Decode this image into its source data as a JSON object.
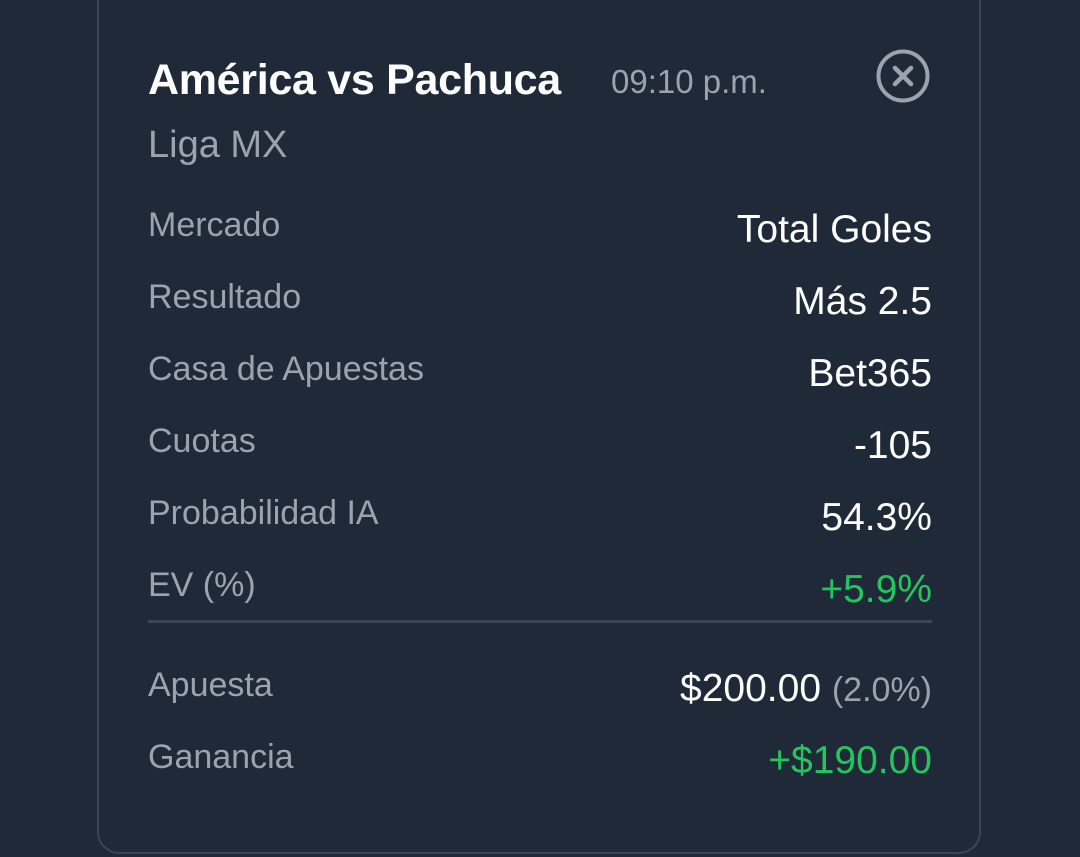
{
  "header": {
    "match": "América vs Pachuca",
    "time": "09:10 p.m.",
    "league": "Liga MX"
  },
  "details": {
    "market_label": "Mercado",
    "market_value": "Total Goles",
    "result_label": "Resultado",
    "result_value": "Más 2.5",
    "bookmaker_label": "Casa de Apuestas",
    "bookmaker_value": "Bet365",
    "odds_label": "Cuotas",
    "odds_value": "-105",
    "probability_label": "Probabilidad IA",
    "probability_value": "54.3%",
    "ev_label": "EV (%)",
    "ev_value": "+5.9%"
  },
  "summary": {
    "stake_label": "Apuesta",
    "stake_value": "$200.00",
    "stake_percent": "(2.0%)",
    "profit_label": "Ganancia",
    "profit_value": "+$190.00"
  },
  "icons": {
    "close": "close-circle-icon"
  },
  "colors": {
    "background": "#1f2937",
    "positive": "#22c55e",
    "muted": "#9ca3af",
    "border": "#3b4557"
  }
}
